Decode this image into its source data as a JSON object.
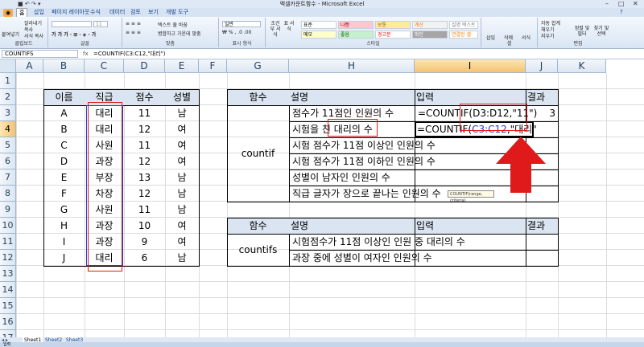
{
  "window": {
    "title": "엑셀카운트함수 - Microsoft Excel"
  },
  "ribbon_tabs": [
    "홈",
    "삽입",
    "페이지 레이아웃",
    "수식",
    "데이터",
    "검토",
    "보기",
    "개발 도구"
  ],
  "ribbon": {
    "groups": [
      "클립보드",
      "글꼴",
      "맞춤",
      "표시 형식",
      "스타일",
      "셀",
      "편집"
    ],
    "clipboard": {
      "paste": "붙여넣기",
      "cut": "잘라내기",
      "copy": "복사",
      "format_painter": "서식 복사"
    },
    "font": {
      "name": "",
      "size": "11"
    },
    "alignment": {
      "wrap": "텍스트 줄 바꿈",
      "merge": "병합하고 가운데 맞춤"
    },
    "number": {
      "format": "일반"
    },
    "styles": {
      "conditional": "조건부 서식",
      "table": "표 서식",
      "cell_style": "셀 스타일",
      "cells": [
        "표준",
        "나쁨",
        "보통",
        "계산",
        "메모",
        "좋음",
        "경고문",
        "설명 텍스트",
        "확인",
        "연결된 셀"
      ]
    },
    "cells": {
      "insert": "삽입",
      "delete": "삭제",
      "format": "서식"
    },
    "editing": {
      "autosum": "자동 합계",
      "fill": "채우기",
      "clear": "지우기",
      "sort": "정렬 및 필터",
      "find": "찾기 및 선택"
    }
  },
  "formula_bar": {
    "name_box": "COUNTIFS",
    "fx": "fx",
    "formula": "=COUNTIF(C3:C12,\"대리\")"
  },
  "columns": [
    "A",
    "B",
    "C",
    "D",
    "E",
    "F",
    "G",
    "H",
    "I",
    "J",
    "K"
  ],
  "rows": [
    "1",
    "2",
    "3",
    "4",
    "5",
    "6",
    "7",
    "8",
    "9",
    "10",
    "11",
    "12",
    "13",
    "14",
    "15",
    "16",
    "17"
  ],
  "table1": {
    "headers": [
      "이름",
      "직급",
      "점수",
      "성별"
    ],
    "rows": [
      [
        "A",
        "대리",
        "11",
        "남"
      ],
      [
        "B",
        "대리",
        "12",
        "여"
      ],
      [
        "C",
        "사원",
        "11",
        "여"
      ],
      [
        "D",
        "과장",
        "12",
        "여"
      ],
      [
        "E",
        "부장",
        "13",
        "남"
      ],
      [
        "F",
        "차장",
        "12",
        "남"
      ],
      [
        "G",
        "사원",
        "11",
        "남"
      ],
      [
        "H",
        "과장",
        "10",
        "여"
      ],
      [
        "I",
        "과장",
        "9",
        "여"
      ],
      [
        "J",
        "대리",
        "6",
        "남"
      ]
    ]
  },
  "table2": {
    "headers": [
      "함수",
      "설명",
      "입력",
      "결과"
    ],
    "func": "countif",
    "rows": [
      {
        "desc": "점수가 11점인 인원의 수",
        "input": "=COUNTIF(D3:D12,\"11\")",
        "result": "3"
      },
      {
        "desc": "시험을 친 대리의 수",
        "input": "",
        "result": ""
      },
      {
        "desc": "시험 점수가 11점 이상인 인원의 수",
        "input": "",
        "result": ""
      },
      {
        "desc": "시험 점수가 11점 이하인 인원의 수",
        "input": "",
        "result": ""
      },
      {
        "desc": "성별이 남자인 인원의 수",
        "input": "",
        "result": ""
      },
      {
        "desc": "직급 글자가 장으로 끝나는 인원의 수",
        "input": "",
        "result": ""
      }
    ],
    "edit_prefix": "=COUNTIF(",
    "edit_range": "C3:C12",
    "edit_suffix": ",\"대리\"",
    "tooltip": "COUNTIF(range, criteria)"
  },
  "table3": {
    "headers": [
      "함수",
      "설명",
      "입력",
      "결과"
    ],
    "func": "countifs",
    "rows": [
      {
        "desc": "시험점수가 11점 이상인 인원 중 대리의 수"
      },
      {
        "desc": "과장 중에 성별이 여자인 인원의 수"
      }
    ]
  },
  "sheet_tabs": [
    "Sheet1",
    "Sheet2",
    "Sheet3"
  ],
  "status": {
    "mode": "입력"
  },
  "colors": {
    "accent": "#e0191a",
    "header_fill": "#dbe5f1",
    "range_blue": "#2140c8"
  }
}
